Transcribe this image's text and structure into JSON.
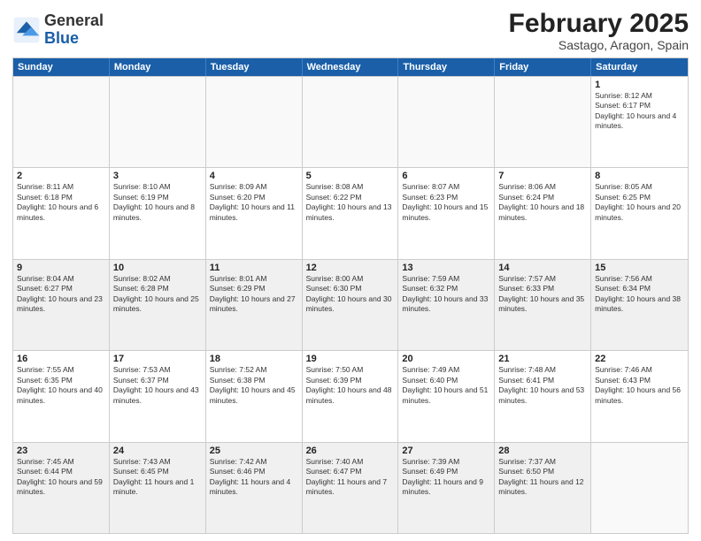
{
  "header": {
    "logo_general": "General",
    "logo_blue": "Blue",
    "title": "February 2025",
    "subtitle": "Sastago, Aragon, Spain"
  },
  "weekdays": [
    "Sunday",
    "Monday",
    "Tuesday",
    "Wednesday",
    "Thursday",
    "Friday",
    "Saturday"
  ],
  "rows": [
    [
      {
        "day": "",
        "text": "",
        "empty": true
      },
      {
        "day": "",
        "text": "",
        "empty": true
      },
      {
        "day": "",
        "text": "",
        "empty": true
      },
      {
        "day": "",
        "text": "",
        "empty": true
      },
      {
        "day": "",
        "text": "",
        "empty": true
      },
      {
        "day": "",
        "text": "",
        "empty": true
      },
      {
        "day": "1",
        "text": "Sunrise: 8:12 AM\nSunset: 6:17 PM\nDaylight: 10 hours and 4 minutes."
      }
    ],
    [
      {
        "day": "2",
        "text": "Sunrise: 8:11 AM\nSunset: 6:18 PM\nDaylight: 10 hours and 6 minutes."
      },
      {
        "day": "3",
        "text": "Sunrise: 8:10 AM\nSunset: 6:19 PM\nDaylight: 10 hours and 8 minutes."
      },
      {
        "day": "4",
        "text": "Sunrise: 8:09 AM\nSunset: 6:20 PM\nDaylight: 10 hours and 11 minutes."
      },
      {
        "day": "5",
        "text": "Sunrise: 8:08 AM\nSunset: 6:22 PM\nDaylight: 10 hours and 13 minutes."
      },
      {
        "day": "6",
        "text": "Sunrise: 8:07 AM\nSunset: 6:23 PM\nDaylight: 10 hours and 15 minutes."
      },
      {
        "day": "7",
        "text": "Sunrise: 8:06 AM\nSunset: 6:24 PM\nDaylight: 10 hours and 18 minutes."
      },
      {
        "day": "8",
        "text": "Sunrise: 8:05 AM\nSunset: 6:25 PM\nDaylight: 10 hours and 20 minutes."
      }
    ],
    [
      {
        "day": "9",
        "text": "Sunrise: 8:04 AM\nSunset: 6:27 PM\nDaylight: 10 hours and 23 minutes.",
        "shaded": true
      },
      {
        "day": "10",
        "text": "Sunrise: 8:02 AM\nSunset: 6:28 PM\nDaylight: 10 hours and 25 minutes.",
        "shaded": true
      },
      {
        "day": "11",
        "text": "Sunrise: 8:01 AM\nSunset: 6:29 PM\nDaylight: 10 hours and 27 minutes.",
        "shaded": true
      },
      {
        "day": "12",
        "text": "Sunrise: 8:00 AM\nSunset: 6:30 PM\nDaylight: 10 hours and 30 minutes.",
        "shaded": true
      },
      {
        "day": "13",
        "text": "Sunrise: 7:59 AM\nSunset: 6:32 PM\nDaylight: 10 hours and 33 minutes.",
        "shaded": true
      },
      {
        "day": "14",
        "text": "Sunrise: 7:57 AM\nSunset: 6:33 PM\nDaylight: 10 hours and 35 minutes.",
        "shaded": true
      },
      {
        "day": "15",
        "text": "Sunrise: 7:56 AM\nSunset: 6:34 PM\nDaylight: 10 hours and 38 minutes.",
        "shaded": true
      }
    ],
    [
      {
        "day": "16",
        "text": "Sunrise: 7:55 AM\nSunset: 6:35 PM\nDaylight: 10 hours and 40 minutes."
      },
      {
        "day": "17",
        "text": "Sunrise: 7:53 AM\nSunset: 6:37 PM\nDaylight: 10 hours and 43 minutes."
      },
      {
        "day": "18",
        "text": "Sunrise: 7:52 AM\nSunset: 6:38 PM\nDaylight: 10 hours and 45 minutes."
      },
      {
        "day": "19",
        "text": "Sunrise: 7:50 AM\nSunset: 6:39 PM\nDaylight: 10 hours and 48 minutes."
      },
      {
        "day": "20",
        "text": "Sunrise: 7:49 AM\nSunset: 6:40 PM\nDaylight: 10 hours and 51 minutes."
      },
      {
        "day": "21",
        "text": "Sunrise: 7:48 AM\nSunset: 6:41 PM\nDaylight: 10 hours and 53 minutes."
      },
      {
        "day": "22",
        "text": "Sunrise: 7:46 AM\nSunset: 6:43 PM\nDaylight: 10 hours and 56 minutes."
      }
    ],
    [
      {
        "day": "23",
        "text": "Sunrise: 7:45 AM\nSunset: 6:44 PM\nDaylight: 10 hours and 59 minutes.",
        "shaded": true
      },
      {
        "day": "24",
        "text": "Sunrise: 7:43 AM\nSunset: 6:45 PM\nDaylight: 11 hours and 1 minute.",
        "shaded": true
      },
      {
        "day": "25",
        "text": "Sunrise: 7:42 AM\nSunset: 6:46 PM\nDaylight: 11 hours and 4 minutes.",
        "shaded": true
      },
      {
        "day": "26",
        "text": "Sunrise: 7:40 AM\nSunset: 6:47 PM\nDaylight: 11 hours and 7 minutes.",
        "shaded": true
      },
      {
        "day": "27",
        "text": "Sunrise: 7:39 AM\nSunset: 6:49 PM\nDaylight: 11 hours and 9 minutes.",
        "shaded": true
      },
      {
        "day": "28",
        "text": "Sunrise: 7:37 AM\nSunset: 6:50 PM\nDaylight: 11 hours and 12 minutes.",
        "shaded": true
      },
      {
        "day": "",
        "text": "",
        "empty": true,
        "shaded": true
      }
    ]
  ]
}
